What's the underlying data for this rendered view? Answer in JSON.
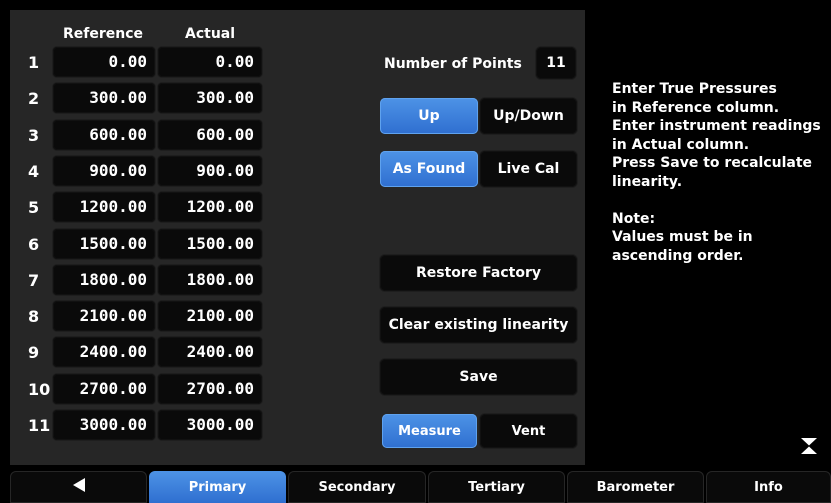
{
  "table": {
    "header_reference": "Reference",
    "header_actual": "Actual",
    "rows": [
      {
        "num": "1",
        "reference": "0.00",
        "actual": "0.00"
      },
      {
        "num": "2",
        "reference": "300.00",
        "actual": "300.00"
      },
      {
        "num": "3",
        "reference": "600.00",
        "actual": "600.00"
      },
      {
        "num": "4",
        "reference": "900.00",
        "actual": "900.00"
      },
      {
        "num": "5",
        "reference": "1200.00",
        "actual": "1200.00"
      },
      {
        "num": "6",
        "reference": "1500.00",
        "actual": "1500.00"
      },
      {
        "num": "7",
        "reference": "1800.00",
        "actual": "1800.00"
      },
      {
        "num": "8",
        "reference": "2100.00",
        "actual": "2100.00"
      },
      {
        "num": "9",
        "reference": "2400.00",
        "actual": "2400.00"
      },
      {
        "num": "10",
        "reference": "2700.00",
        "actual": "2700.00"
      },
      {
        "num": "11",
        "reference": "3000.00",
        "actual": "3000.00"
      }
    ]
  },
  "controls": {
    "number_of_points_label": "Number of Points",
    "number_of_points_value": "11",
    "direction": {
      "up": "Up",
      "updown": "Up/Down",
      "selected": "Up"
    },
    "mode": {
      "as_found": "As Found",
      "live_cal": "Live Cal",
      "selected": "As Found"
    },
    "restore_factory": "Restore Factory",
    "clear_linearity": "Clear existing linearity",
    "save": "Save",
    "measure": "Measure",
    "vent": "Vent",
    "measure_selected": true
  },
  "instructions": "Enter True Pressures\nin Reference column.\nEnter instrument readings\nin Actual column.\nPress Save to recalculate\nlinearity.\n\nNote:\nValues must be in\nascending order.",
  "footer": {
    "back_icon": "left-triangle-icon",
    "tabs": [
      "Primary",
      "Secondary",
      "Tertiary",
      "Barometer",
      "Info"
    ],
    "selected": "Primary"
  },
  "collapse_icon": "hourglass-collapse-icon",
  "colors": {
    "accent": "#3a80dc",
    "panel": "#262626",
    "background": "#000000"
  }
}
